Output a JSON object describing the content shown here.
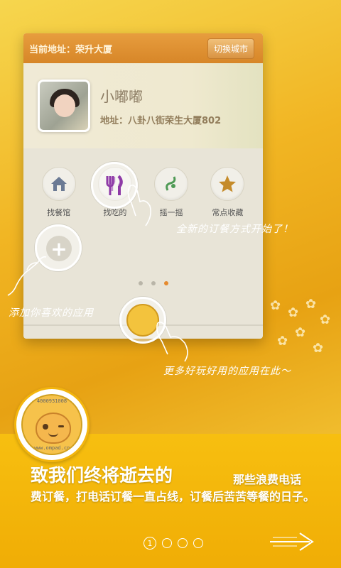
{
  "header": {
    "current_address": "当前地址：荣升大厦",
    "switch_city": "切换城市"
  },
  "profile": {
    "name": "小嘟嘟",
    "address": "地址：八卦八街荣生大厦802"
  },
  "apps": [
    {
      "label": "找餐馆",
      "icon": "house-icon"
    },
    {
      "label": "找吃的",
      "icon": "fork-knife-icon"
    },
    {
      "label": "摇一摇",
      "icon": "shake-icon"
    },
    {
      "label": "常点收藏",
      "icon": "star-icon"
    }
  ],
  "page_dots": {
    "count": 3,
    "active_index": 2
  },
  "annotations": {
    "new_order": "全新的订餐方式开始了！",
    "add_apps": "添加你喜欢的应用",
    "more_apps": "更多好玩好用的应用在此～"
  },
  "badge": {
    "top_text": "4000931008",
    "bottom_text": "www.ompad.cn"
  },
  "intro": {
    "headline": "致我们终将逝去的",
    "subline": "那些浪费电话",
    "body": "费订餐，打电话订餐一直占线，订餐后苦苦等餐的日子。"
  },
  "pager": {
    "current": "1",
    "total": 4
  },
  "colors": {
    "accent": "#e58a2e",
    "panel": "#f3b50d",
    "header": "#dd8e30"
  }
}
